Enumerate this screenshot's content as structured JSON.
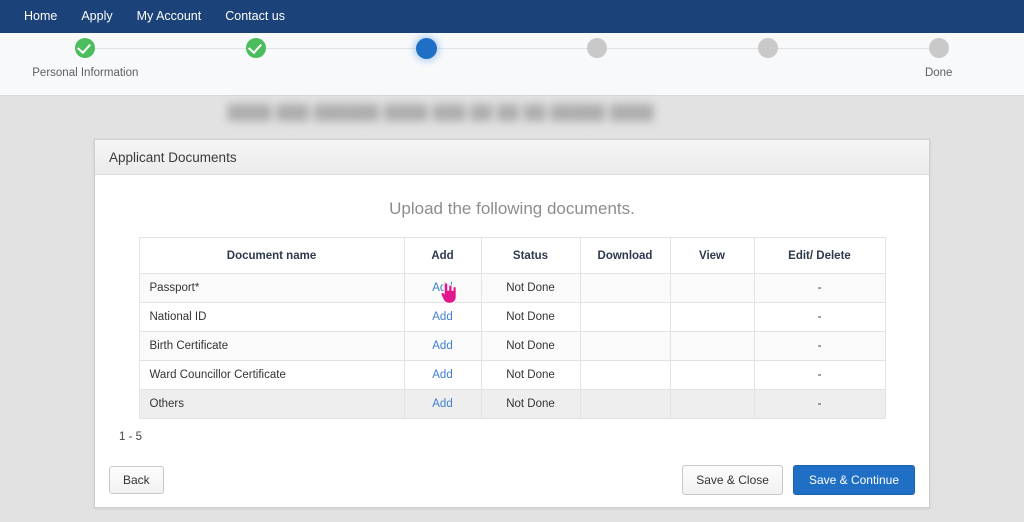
{
  "navbar": {
    "items": [
      {
        "label": "Home"
      },
      {
        "label": "Apply"
      },
      {
        "label": "My Account"
      },
      {
        "label": "Contact us"
      }
    ],
    "background": "#1b4279"
  },
  "stepper": {
    "colors": {
      "done": "#4cbd5c",
      "active": "#1f6fc4",
      "pending": "#c9c9c9"
    },
    "steps": [
      {
        "label": "Personal Information",
        "state": "done",
        "blurred": false
      },
      {
        "label": "",
        "state": "done",
        "blurred": true
      },
      {
        "label": "",
        "state": "active",
        "blurred": true
      },
      {
        "label": "",
        "state": "pending",
        "blurred": true
      },
      {
        "label": "",
        "state": "pending",
        "blurred": true
      },
      {
        "label": "Done",
        "state": "pending",
        "blurred": false
      }
    ]
  },
  "banner": {
    "blurred_text": "████ ███ ██████ ████ ███ ██ ██ ██ █████ ████"
  },
  "card": {
    "title": "Applicant Documents",
    "heading": "Upload the following documents.",
    "table": {
      "headers": {
        "name": "Document name",
        "add": "Add",
        "status": "Status",
        "download": "Download",
        "view": "View",
        "edit": "Edit/ Delete"
      },
      "rows": [
        {
          "name": "Passport",
          "required": "*",
          "add": "Add",
          "status": "Not Done",
          "download": "",
          "view": "",
          "edit": "-"
        },
        {
          "name": "National ID",
          "required": "",
          "add": "Add",
          "status": "Not Done",
          "download": "",
          "view": "",
          "edit": "-"
        },
        {
          "name": "Birth Certificate",
          "required": "",
          "add": "Add",
          "status": "Not Done",
          "download": "",
          "view": "",
          "edit": "-"
        },
        {
          "name": "Ward Councillor Certificate",
          "required": "",
          "add": "Add",
          "status": "Not Done",
          "download": "",
          "view": "",
          "edit": "-"
        },
        {
          "name": "Others",
          "required": "",
          "add": "Add",
          "status": "Not Done",
          "download": "",
          "view": "",
          "edit": "-"
        }
      ]
    },
    "pager": "1 - 5",
    "buttons": {
      "back": "Back",
      "save_close": "Save & Close",
      "save_continue": "Save & Continue"
    }
  },
  "cursor": {
    "color": "#e2188f"
  }
}
